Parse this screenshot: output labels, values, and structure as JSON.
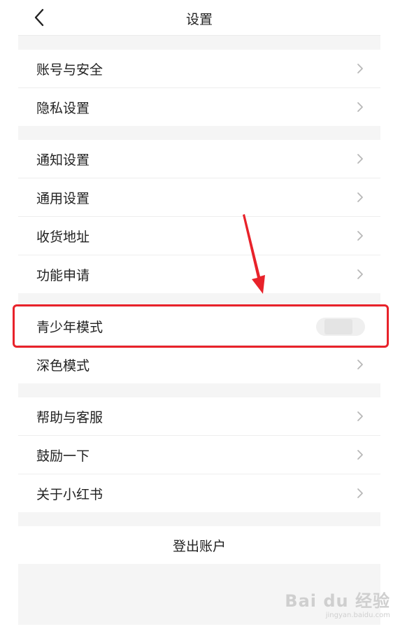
{
  "header": {
    "title": "设置"
  },
  "groups": [
    {
      "items": [
        {
          "label": "账号与安全"
        },
        {
          "label": "隐私设置"
        }
      ]
    },
    {
      "items": [
        {
          "label": "通知设置"
        },
        {
          "label": "通用设置"
        },
        {
          "label": "收货地址"
        },
        {
          "label": "功能申请"
        }
      ]
    },
    {
      "items": [
        {
          "label": "青少年模式",
          "control": "toggle"
        },
        {
          "label": "深色模式"
        }
      ]
    },
    {
      "items": [
        {
          "label": "帮助与客服"
        },
        {
          "label": "鼓励一下"
        },
        {
          "label": "关于小红书"
        }
      ]
    }
  ],
  "logout": {
    "label": "登出账户"
  },
  "annotation": {
    "color": "#e8222a"
  },
  "watermark": {
    "main": "Bai du 经验",
    "sub": "jingyan.baidu.com"
  },
  "icons": {
    "back": "chevron-left-icon",
    "row_arrow": "chevron-right-icon"
  }
}
